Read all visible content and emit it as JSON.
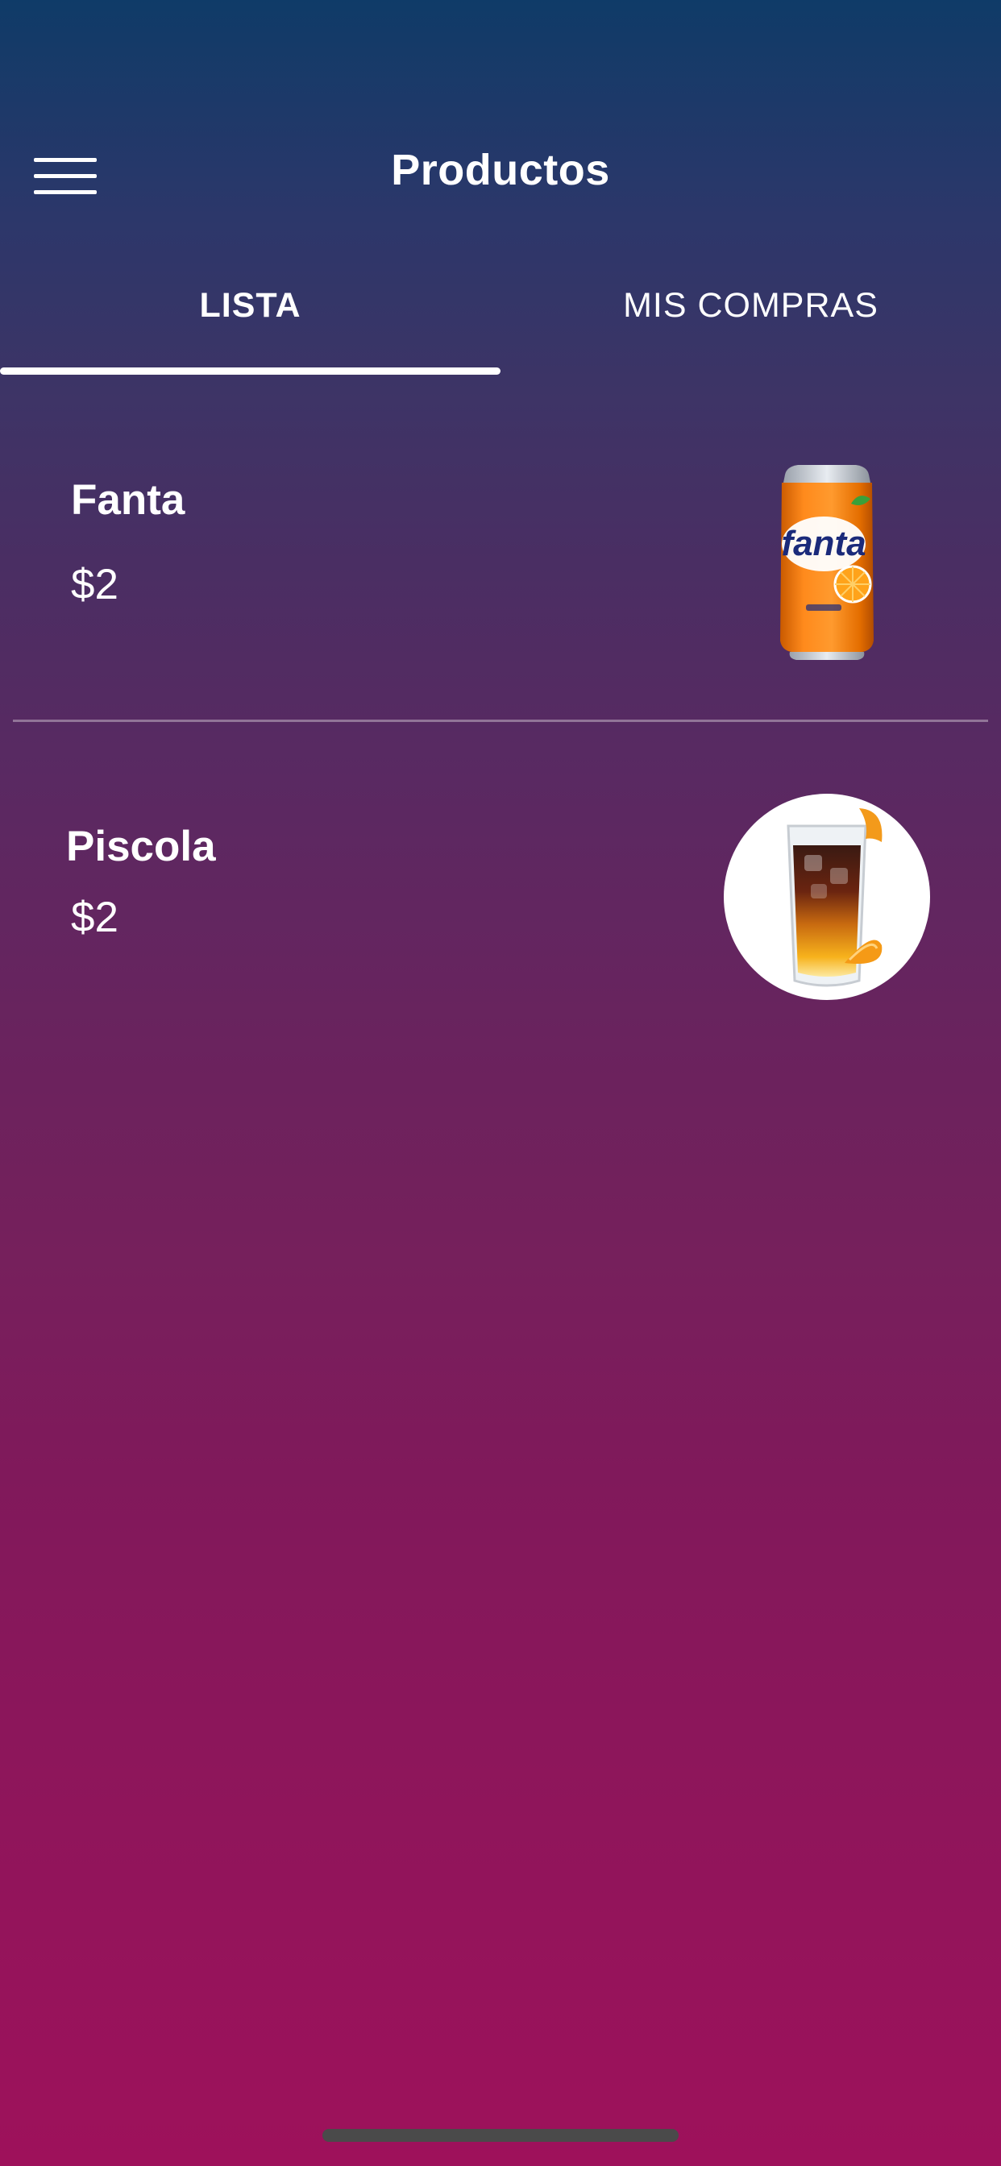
{
  "header": {
    "title": "Productos",
    "menu_icon": "hamburger-menu-icon"
  },
  "tabs": [
    {
      "label": "LISTA",
      "active": true
    },
    {
      "label": "MIS COMPRAS",
      "active": false
    }
  ],
  "products": [
    {
      "name": "Fanta",
      "price": "$2",
      "image": "fanta-can-image"
    },
    {
      "name": "Piscola",
      "price": "$2",
      "image": "piscola-glass-image"
    }
  ],
  "colors": {
    "gradient_top": "#0f3b68",
    "gradient_bottom": "#9e115b",
    "text": "#ffffff"
  }
}
